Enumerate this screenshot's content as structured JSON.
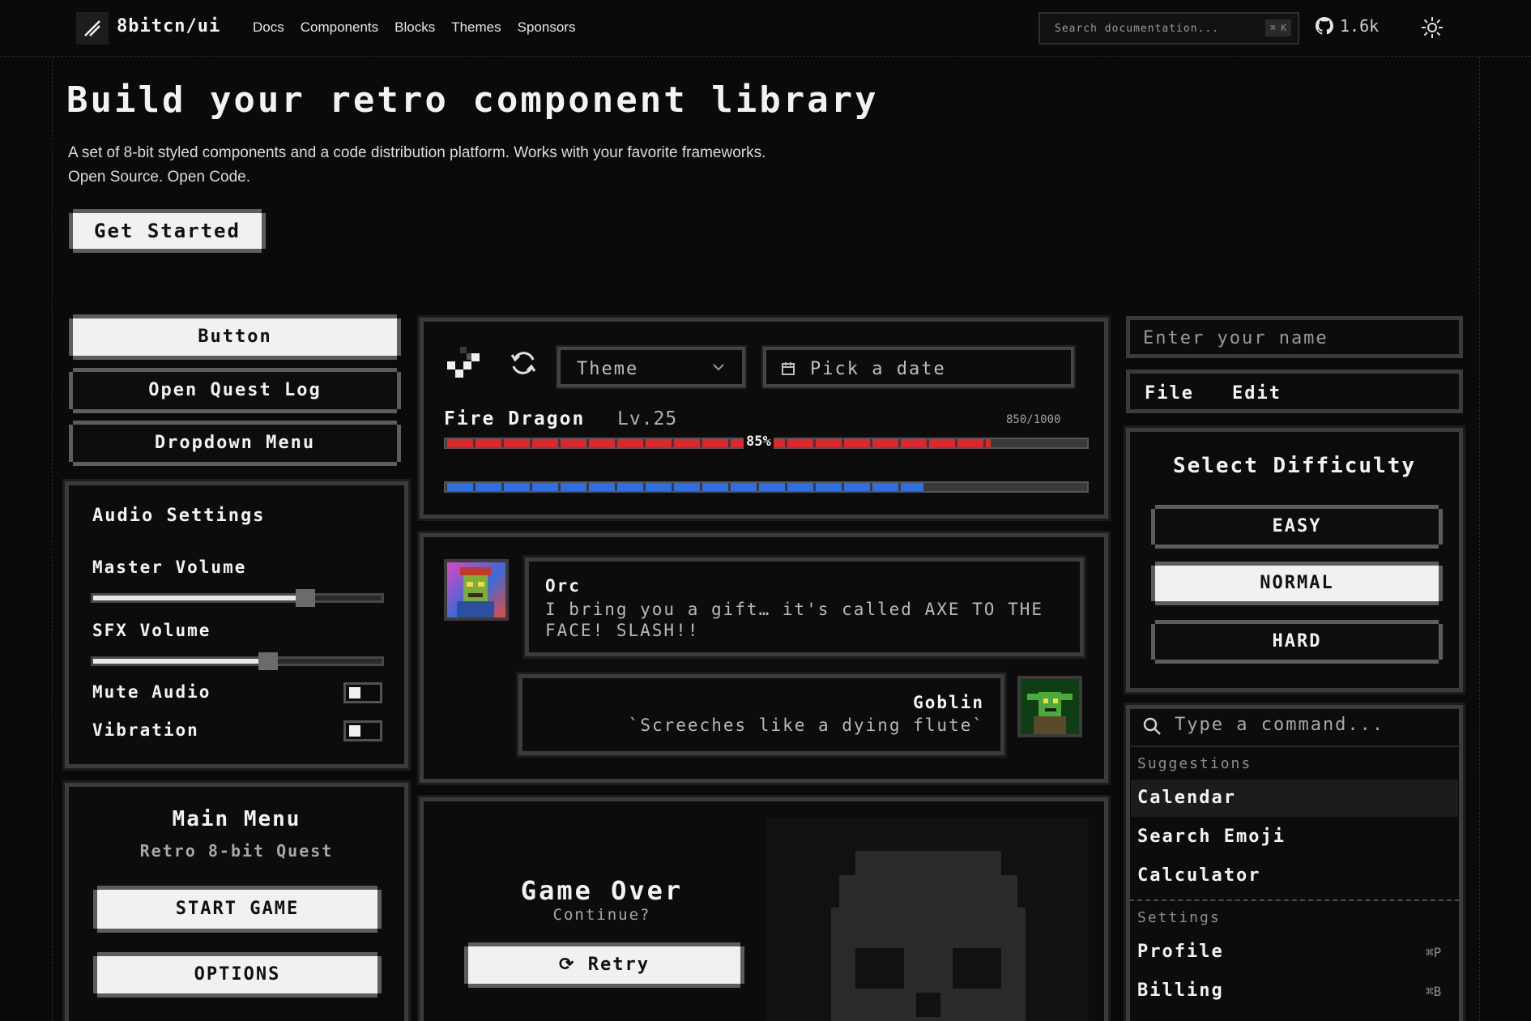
{
  "nav": {
    "brand": "8bitcn/ui",
    "links": [
      "Docs",
      "Components",
      "Blocks",
      "Themes",
      "Sponsors"
    ],
    "search_placeholder": "Search documentation...",
    "search_shortcut": "⌘ K",
    "github_stars": "1.6k",
    "icons": {
      "logo": "slash-logo-icon",
      "github": "github-icon",
      "theme": "sun-icon"
    }
  },
  "hero": {
    "title": "Build your retro component library",
    "description": "A set of 8-bit styled components and a code distribution platform. Works with your favorite frameworks. Open Source. Open Code.",
    "cta": "Get Started"
  },
  "left": {
    "buttons": [
      "Button",
      "Open Quest Log",
      "Dropdown Menu"
    ],
    "audio": {
      "title": "Audio Settings",
      "master_label": "Master Volume",
      "master_value": 0.73,
      "sfx_label": "SFX Volume",
      "sfx_value": 0.6,
      "mute_label": "Mute Audio",
      "mute_on": false,
      "vibration_label": "Vibration",
      "vibration_on": false
    },
    "menu": {
      "title": "Main Menu",
      "subtitle": "Retro 8-bit Quest",
      "start": "START GAME",
      "options": "OPTIONS"
    }
  },
  "center": {
    "theme_select": "Theme",
    "date_picker": "Pick a date",
    "boss": {
      "name": "Fire Dragon",
      "level": "Lv.25",
      "hp_text": "850/1000",
      "hp_percent_label": "85%",
      "hp_fraction": 0.85,
      "mana_fraction": 0.745
    },
    "dialog": [
      {
        "speaker": "Orc",
        "text": "I bring you a gift… it's called AXE TO THE FACE! SLASH!!"
      },
      {
        "speaker": "Goblin",
        "text": "`Screeches like a dying flute`"
      }
    ],
    "game_over": {
      "title": "Game Over",
      "subtitle": "Continue?",
      "retry": "Retry"
    }
  },
  "right": {
    "name_placeholder": "Enter your name",
    "menubar": [
      "File",
      "Edit"
    ],
    "difficulty": {
      "title": "Select Difficulty",
      "options": [
        "EASY",
        "NORMAL",
        "HARD"
      ],
      "selected": "NORMAL"
    },
    "command": {
      "placeholder": "Type a command...",
      "suggestions_header": "Suggestions",
      "suggestions": [
        "Calendar",
        "Search Emoji",
        "Calculator"
      ],
      "settings_header": "Settings",
      "settings": [
        {
          "label": "Profile",
          "shortcut": "⌘P"
        },
        {
          "label": "Billing",
          "shortcut": "⌘B"
        }
      ]
    }
  },
  "colors": {
    "hp": "#e0262d",
    "mana": "#2f6fe4",
    "accent": "#f1f1f1",
    "bg": "#0a0a0a"
  }
}
